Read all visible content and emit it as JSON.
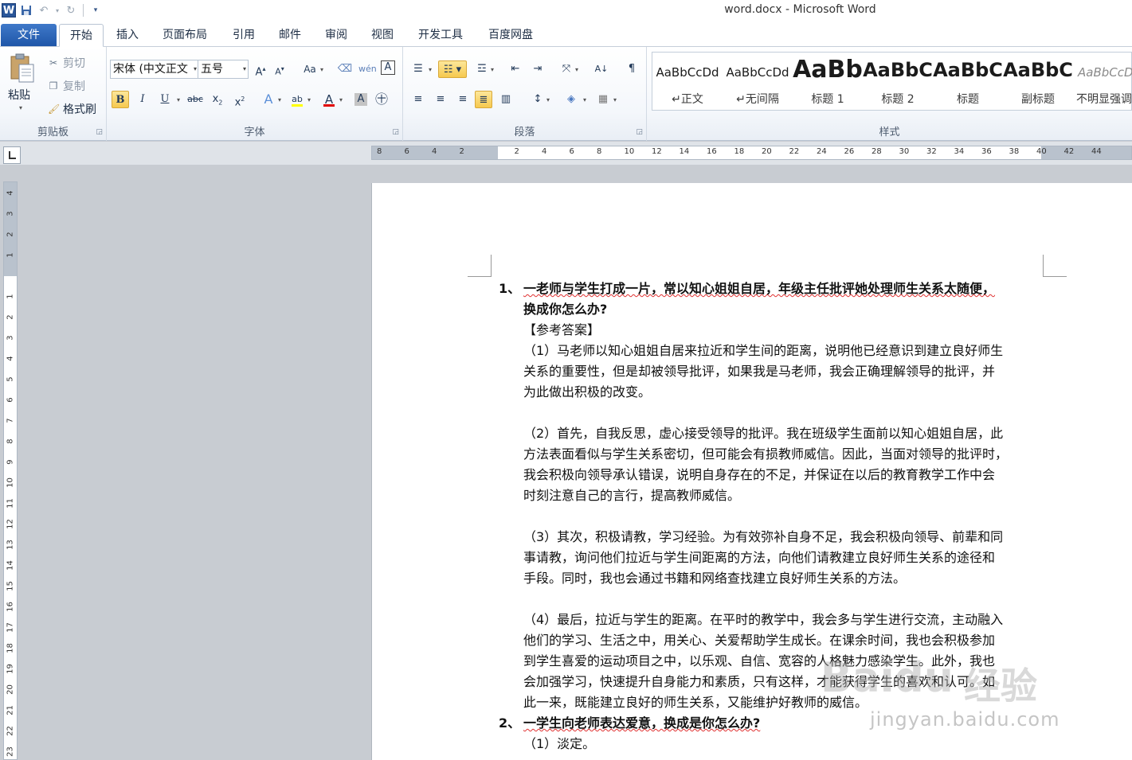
{
  "window": {
    "title": "word.docx - Microsoft Word"
  },
  "qat": {
    "logo": "W"
  },
  "tabs": {
    "file": "文件",
    "items": [
      "开始",
      "插入",
      "页面布局",
      "引用",
      "邮件",
      "审阅",
      "视图",
      "开发工具",
      "百度网盘"
    ],
    "active": "开始"
  },
  "ribbon": {
    "clipboard": {
      "paste": "粘贴",
      "cut": "剪切",
      "copy": "复制",
      "format_painter": "格式刷",
      "label": "剪贴板"
    },
    "font": {
      "font_name": "宋体 (中文正文",
      "font_size": "五号",
      "label": "字体",
      "color_accent": "#e00000",
      "highlight": "#ffff00"
    },
    "paragraph": {
      "label": "段落"
    },
    "styles": {
      "label": "样式",
      "items": [
        {
          "sample": "AaBbCcDd",
          "name": "↵正文"
        },
        {
          "sample": "AaBbCcDd",
          "name": "↵无间隔"
        },
        {
          "sample": "AaBb",
          "name": "标题 1"
        },
        {
          "sample": "AaBbC",
          "name": "标题 2"
        },
        {
          "sample": "AaBbC",
          "name": "标题"
        },
        {
          "sample": "AaBbC",
          "name": "副标题"
        },
        {
          "sample": "AaBbCcDd",
          "name": "不明显强调"
        }
      ]
    }
  },
  "ruler": {
    "h_ticks": [
      "8",
      "6",
      "4",
      "2",
      "",
      "2",
      "4",
      "6",
      "8",
      "10",
      "12",
      "14",
      "16",
      "18",
      "20",
      "22",
      "24",
      "26",
      "28",
      "30",
      "32",
      "34",
      "36",
      "38",
      "40",
      "42",
      "44"
    ],
    "v_ticks": [
      "4",
      "3",
      "2",
      "1",
      "",
      "1",
      "2",
      "3",
      "4",
      "5",
      "6",
      "7",
      "8",
      "9",
      "10",
      "11",
      "12",
      "13",
      "14",
      "15",
      "16",
      "17",
      "18",
      "19",
      "20",
      "21",
      "22",
      "23"
    ]
  },
  "document": {
    "q1_num": "1、",
    "q1_line1": "一老师与学生打成一片，常以知心姐姐自居，年级主任批评她处理师生关系太随便，",
    "q1_line2": "换成你怎么办?",
    "ref": "【参考答案】",
    "p1": [
      "（1）马老师以知心姐姐自居来拉近和学生间的距离，说明他已经意识到建立良好师生",
      "关系的重要性，但是却被领导批评，如果我是马老师，我会正确理解领导的批评，并",
      "为此做出积极的改变。"
    ],
    "p2": [
      "（2）首先，自我反思，虚心接受领导的批评。我在班级学生面前以知心姐姐自居，此",
      "方法表面看似与学生关系密切，但可能会有损教师威信。因此，当面对领导的批评时，",
      "我会积极向领导承认错误，说明自身存在的不足，并保证在以后的教育教学工作中会",
      "时刻注意自己的言行，提高教师威信。"
    ],
    "p3": [
      "（3）其次，积极请教，学习经验。为有效弥补自身不足，我会积极向领导、前辈和同",
      "事请教，询问他们拉近与学生间距离的方法，向他们请教建立良好师生关系的途径和",
      "手段。同时，我也会通过书籍和网络查找建立良好师生关系的方法。"
    ],
    "p4": [
      "（4）最后，拉近与学生的距离。在平时的教学中，我会多与学生进行交流，主动融入",
      "他们的学习、生活之中，用关心、关爱帮助学生成长。在课余时间，我也会积极参加",
      "到学生喜爱的运动项目之中，以乐观、自信、宽容的人格魅力感染学生。此外，我也",
      "会加强学习，快速提升自身能力和素质，只有这样，才能获得学生的喜欢和认可。如",
      "此一来，既能建立良好的师生关系，又能维护好教师的威信。"
    ],
    "q2_num": "2、",
    "q2_line1": "一学生向老师表达爱意，换成是你怎么办?",
    "q2_p1": "（1）淡定。"
  },
  "watermark": {
    "brand": "Baidu",
    "jy": "经验",
    "url": "jingyan.baidu.com"
  }
}
